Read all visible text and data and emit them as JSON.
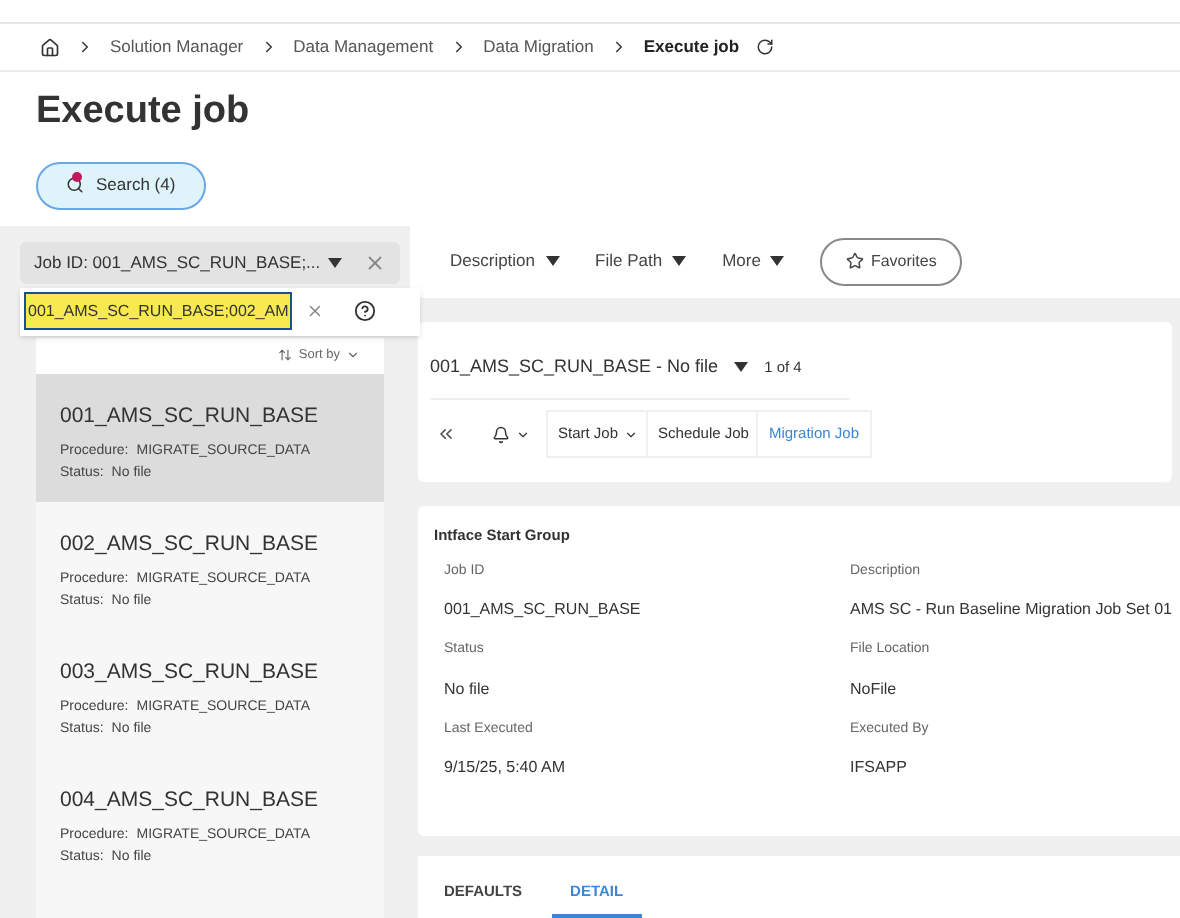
{
  "breadcrumb": [
    {
      "label": "Solution Manager",
      "current": false
    },
    {
      "label": "Data Management",
      "current": false
    },
    {
      "label": "Data Migration",
      "current": false
    },
    {
      "label": "Execute job",
      "current": true
    }
  ],
  "title": "Execute job",
  "search_button": {
    "label": "Search (4)"
  },
  "filter_chip": {
    "label": "Job ID: 001_AMS_SC_RUN_BASE;..."
  },
  "filter_input": {
    "value": "001_AMS_SC_RUN_BASE;002_AM"
  },
  "filters": [
    "Description",
    "File Path",
    "More"
  ],
  "favorites": "Favorites",
  "sort": "Sort by",
  "jobs": [
    {
      "title": "001_AMS_SC_RUN_BASE",
      "procedure_label": "Procedure:",
      "procedure": "MIGRATE_SOURCE_DATA",
      "status_label": "Status:",
      "status": "No file",
      "selected": true
    },
    {
      "title": "002_AMS_SC_RUN_BASE",
      "procedure_label": "Procedure:",
      "procedure": "MIGRATE_SOURCE_DATA",
      "status_label": "Status:",
      "status": "No file",
      "selected": false
    },
    {
      "title": "003_AMS_SC_RUN_BASE",
      "procedure_label": "Procedure:",
      "procedure": "MIGRATE_SOURCE_DATA",
      "status_label": "Status:",
      "status": "No file",
      "selected": false
    },
    {
      "title": "004_AMS_SC_RUN_BASE",
      "procedure_label": "Procedure:",
      "procedure": "MIGRATE_SOURCE_DATA",
      "status_label": "Status:",
      "status": "No file",
      "selected": false
    }
  ],
  "record": {
    "title": "001_AMS_SC_RUN_BASE - No file",
    "counter": "1 of 4"
  },
  "commands": [
    {
      "label": "Start Job",
      "kind": "dropdown"
    },
    {
      "label": "Schedule Job",
      "kind": "plain"
    },
    {
      "label": "Migration Job",
      "kind": "link"
    }
  ],
  "group": {
    "title": "Intface Start Group",
    "fields": [
      {
        "label": "Job ID",
        "value": "001_AMS_SC_RUN_BASE"
      },
      {
        "label": "Description",
        "value": "AMS SC - Run Baseline Migration Job Set 01"
      },
      {
        "label": "Status",
        "value": "No file"
      },
      {
        "label": "File Location",
        "value": "NoFile"
      },
      {
        "label": "Last Executed",
        "value": "9/15/25, 5:40 AM"
      },
      {
        "label": "Executed By",
        "value": "IFSAPP"
      }
    ]
  },
  "tabs": [
    {
      "label": "DEFAULTS",
      "selected": false
    },
    {
      "label": "DETAIL",
      "selected": true
    }
  ]
}
